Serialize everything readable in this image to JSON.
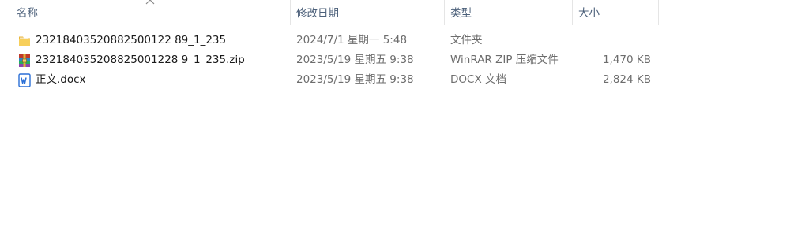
{
  "columns": {
    "name": "名称",
    "date": "修改日期",
    "type": "类型",
    "size": "大小"
  },
  "files": [
    {
      "icon": "folder-icon",
      "name": "23218403520882500122 89_1_235",
      "date": "2024/7/1 星期一 5:48",
      "type": "文件夹",
      "size": ""
    },
    {
      "icon": "winrar-zip-icon",
      "name": "232184035208825001228 9_1_235.zip",
      "date": "2023/5/19 星期五 9:38",
      "type": "WinRAR ZIP 压缩文件",
      "size": "1,470 KB"
    },
    {
      "icon": "word-docx-icon",
      "name": "正文.docx",
      "date": "2023/5/19 星期五 9:38",
      "type": "DOCX 文档",
      "size": "2,824 KB"
    }
  ]
}
